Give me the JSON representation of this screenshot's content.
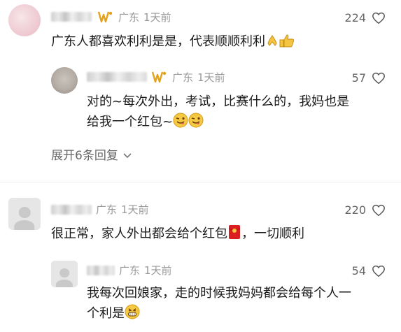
{
  "comments": [
    {
      "location": "广东",
      "time": "1天前",
      "likes": "224",
      "text": "广东人都喜欢利利是是，代表顺顺利利",
      "emoji_icons": [
        "praying-hands-icon",
        "thumbs-up-icon"
      ],
      "replies": [
        {
          "location": "广东",
          "time": "1天前",
          "likes": "57",
          "text_line1": "对的~每次外出，考试，比赛什么的，我妈也是",
          "text_line2": "给我一个红包~",
          "emoji_icons": [
            "wink-tongue-face-icon",
            "wink-tongue-face-icon"
          ]
        }
      ],
      "expand_label": "展开6条回复"
    },
    {
      "location": "广东",
      "time": "1天前",
      "likes": "220",
      "text_before": "很正常，家人外出都会给个红包",
      "text_after": "，一切顺利",
      "emoji_icons": [
        "red-envelope-icon"
      ],
      "replies": [
        {
          "location": "广东",
          "time": "1天前",
          "likes": "54",
          "text_line1": "我每次回娘家，走的时候我妈妈都会给每个人一",
          "text_line2": "个利是",
          "emoji_icons": [
            "grinning-face-icon"
          ]
        }
      ]
    }
  ],
  "colors": {
    "badge": "#e3a21a",
    "meta": "#9a9a9a",
    "text": "#1a1a1a",
    "red_envelope": "#d81e1e"
  }
}
